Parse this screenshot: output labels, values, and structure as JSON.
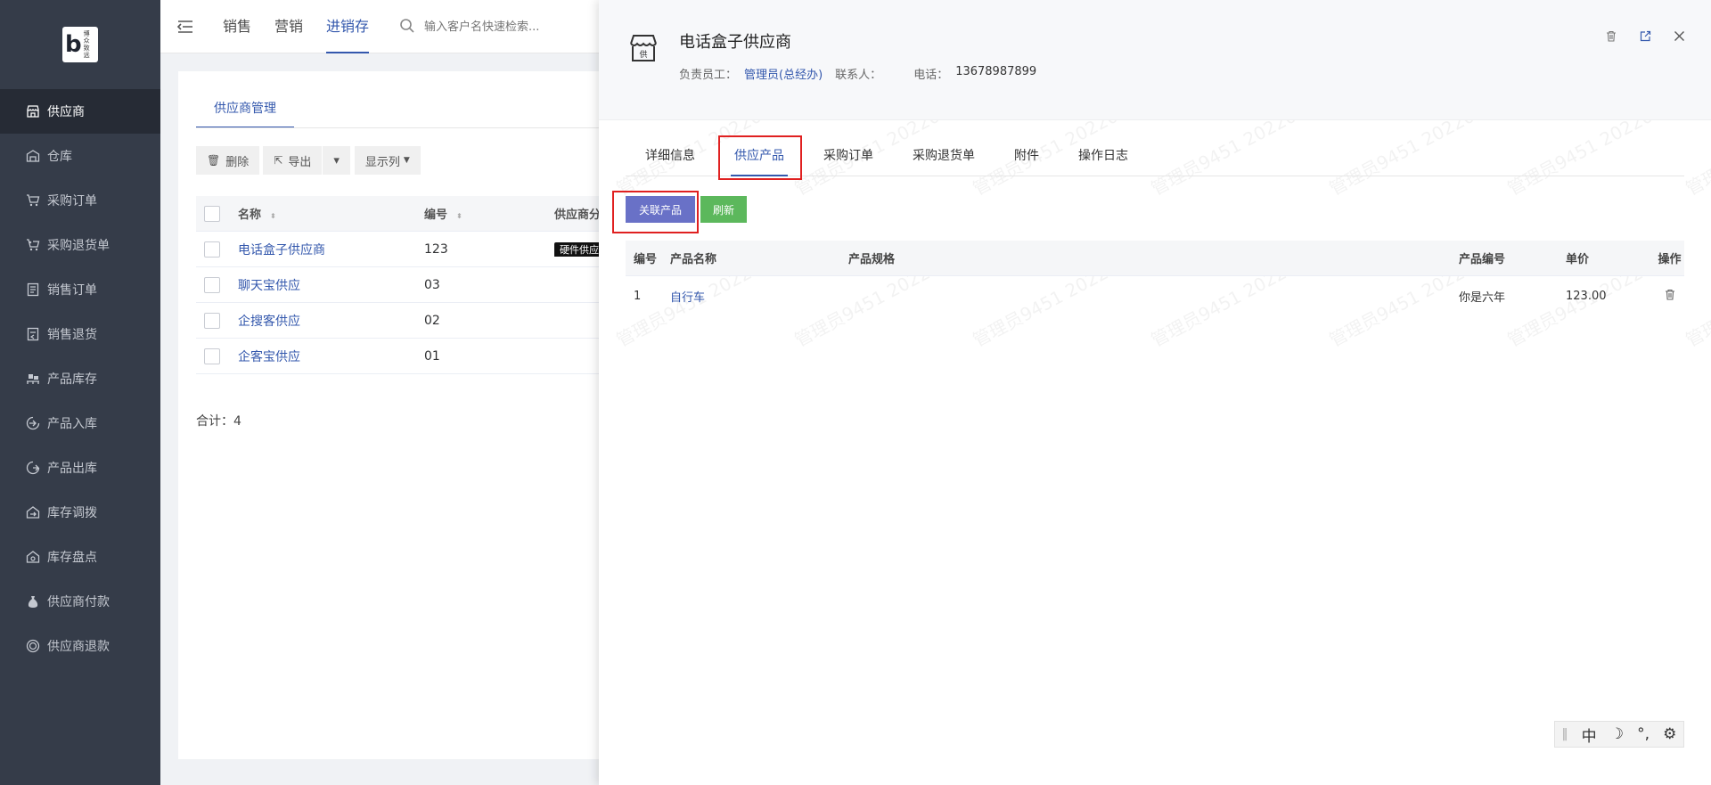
{
  "logo": {
    "mark": "b",
    "text_line1": "博众",
    "text_line2": "致远"
  },
  "sidebar": {
    "items": [
      {
        "label": "供应商",
        "icon": "store-icon",
        "active": true
      },
      {
        "label": "仓库",
        "icon": "warehouse-icon"
      },
      {
        "label": "采购订单",
        "icon": "cart-icon"
      },
      {
        "label": "采购退货单",
        "icon": "cart-return-icon"
      },
      {
        "label": "销售订单",
        "icon": "list-icon"
      },
      {
        "label": "销售退货",
        "icon": "return-doc-icon"
      },
      {
        "label": "产品库存",
        "icon": "pallet-icon"
      },
      {
        "label": "产品入库",
        "icon": "inbound-icon"
      },
      {
        "label": "产品出库",
        "icon": "outbound-icon"
      },
      {
        "label": "库存调拨",
        "icon": "transfer-icon"
      },
      {
        "label": "库存盘点",
        "icon": "inventory-check-icon"
      },
      {
        "label": "供应商付款",
        "icon": "money-bag-icon"
      },
      {
        "label": "供应商退款",
        "icon": "refund-icon"
      }
    ]
  },
  "topbar": {
    "nav": [
      {
        "label": "销售"
      },
      {
        "label": "营销"
      },
      {
        "label": "进销存",
        "active": true
      }
    ],
    "search_placeholder": "输入客户名快速检索..."
  },
  "main": {
    "tab": "供应商管理",
    "toolbar": {
      "delete": "删除",
      "export": "导出",
      "columns": "显示列"
    },
    "table": {
      "headers": {
        "name": "名称",
        "code": "编号",
        "type": "供应商分"
      },
      "rows": [
        {
          "name": "电话盒子供应商",
          "code": "123",
          "type": "硬件供应"
        },
        {
          "name": "聊天宝供应",
          "code": "03",
          "type": ""
        },
        {
          "name": "企搜客供应",
          "code": "02",
          "type": ""
        },
        {
          "name": "企客宝供应",
          "code": "01",
          "type": ""
        }
      ]
    },
    "total": "合计：4"
  },
  "drawer": {
    "title": "电话盒子供应商",
    "store_icon_label": "供",
    "owner_label": "负责员工：",
    "owner": "管理员(总经办)",
    "contact_label": "联系人：",
    "phone_label": "电话：",
    "phone": "13678987899",
    "tabs": [
      {
        "label": "详细信息"
      },
      {
        "label": "供应产品",
        "active": true
      },
      {
        "label": "采购订单"
      },
      {
        "label": "采购退货单"
      },
      {
        "label": "附件"
      },
      {
        "label": "操作日志"
      }
    ],
    "buttons": {
      "link_product": "关联产品",
      "refresh": "刷新"
    },
    "product_table": {
      "headers": {
        "no": "编号",
        "name": "产品名称",
        "spec": "产品规格",
        "code": "产品编号",
        "price": "单价",
        "op": "操作"
      },
      "rows": [
        {
          "no": "1",
          "name": "自行车",
          "spec": "",
          "code": "你是六年",
          "price": "123.00"
        }
      ]
    },
    "watermark": "管理员9451 20220"
  },
  "ime": {
    "lang": "中",
    "moon": "☽",
    "punct": "°,",
    "gear": "⚙"
  }
}
